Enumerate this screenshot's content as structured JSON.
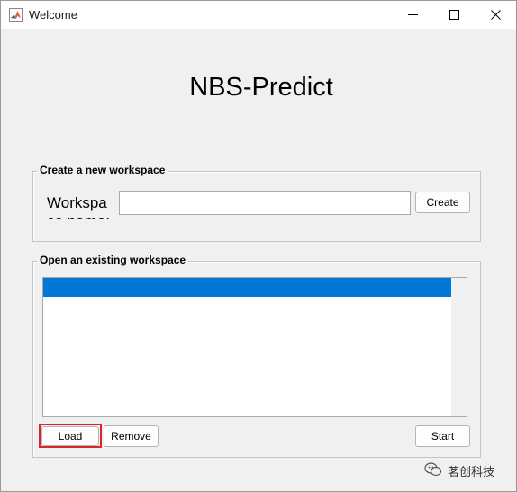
{
  "window": {
    "title": "Welcome"
  },
  "app_title": "NBS-Predict",
  "create_group": {
    "legend": "Create a new workspace",
    "label": "Workspace name:",
    "input_value": "",
    "create_label": "Create"
  },
  "open_group": {
    "legend": "Open an existing workspace",
    "items": [
      ""
    ],
    "load_label": "Load",
    "remove_label": "Remove",
    "start_label": "Start"
  },
  "watermark": {
    "text": "茗创科技"
  },
  "colors": {
    "selection": "#0078d7",
    "highlight": "#d9262c",
    "window_bg": "#f0f0f0"
  }
}
